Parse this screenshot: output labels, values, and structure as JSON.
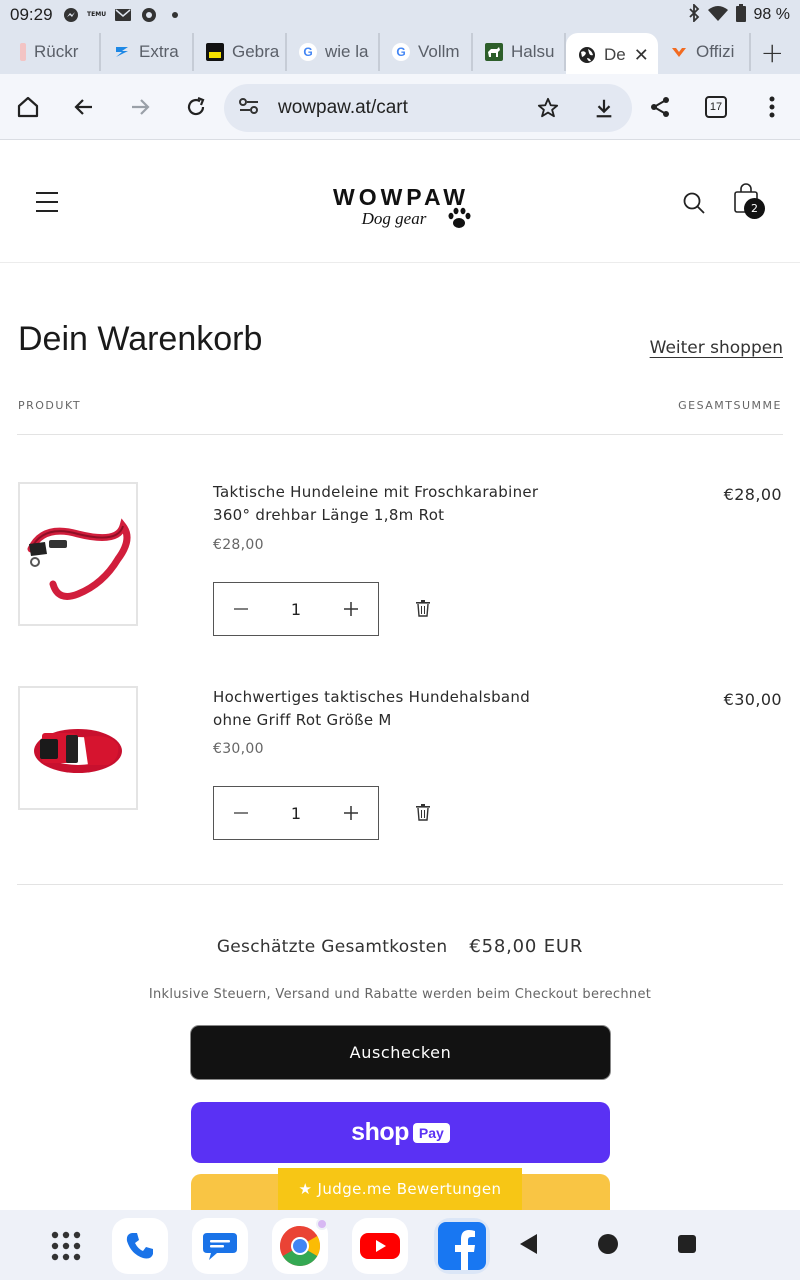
{
  "status_bar": {
    "time": "09:29",
    "battery": "98 %",
    "left_icons": [
      "messenger-icon",
      "temu-icon",
      "mail-icon",
      "chrome-icon",
      "dot-icon"
    ],
    "right_icons": [
      "bluetooth-icon",
      "wifi-icon",
      "battery-icon"
    ]
  },
  "tabs": [
    {
      "label": "Rückr",
      "icon": "rueckruf-favicon",
      "active": false
    },
    {
      "label": "Extra",
      "icon": "extra-favicon",
      "active": false
    },
    {
      "label": "Gebra",
      "icon": "gebra-favicon",
      "active": false
    },
    {
      "label": "wie la",
      "icon": "google-favicon",
      "active": false
    },
    {
      "label": "Vollm",
      "icon": "google-favicon",
      "active": false
    },
    {
      "label": "Halsu",
      "icon": "dog-favicon",
      "active": false
    },
    {
      "label": "De",
      "icon": "globe-favicon",
      "active": true
    },
    {
      "label": "Offizi",
      "icon": "orange-favicon",
      "active": false
    }
  ],
  "browser": {
    "url": "wowpaw.at/cart",
    "tab_count": "17"
  },
  "site": {
    "brand": "WOWPAW",
    "tagline": "Dog gear",
    "cart_count": "2"
  },
  "cart": {
    "title": "Dein Warenkorb",
    "continue_label": "Weiter shoppen",
    "col_product": "PRODUKT",
    "col_total": "GESAMTSUMME",
    "items": [
      {
        "name": "Taktische Hundeleine mit Froschkarabiner 360° drehbar Länge 1,8m Rot",
        "unit_price": "€28,00",
        "line_total": "€28,00",
        "quantity": "1"
      },
      {
        "name": "Hochwertiges taktisches Hundehalsband ohne Griff Rot Größe M",
        "unit_price": "€30,00",
        "line_total": "€30,00",
        "quantity": "1"
      }
    ],
    "subtotal_label": "Geschätzte Gesamtkosten",
    "subtotal_value": "€58,00 EUR",
    "tax_note": "Inklusive Steuern, Versand und Rabatte werden beim Checkout berechnet",
    "checkout_label": "Auschecken",
    "shoppay_shop": "shop",
    "shoppay_pay": "Pay",
    "judgeme_label": "★ Judge.me Bewertungen"
  },
  "taskbar": {
    "apps": [
      "app-drawer-icon",
      "phone-icon",
      "messages-icon",
      "chrome-icon",
      "youtube-icon",
      "facebook-icon"
    ],
    "nav": [
      "back-icon",
      "home-icon",
      "recents-icon"
    ]
  },
  "colors": {
    "shop_pay": "#5a31f4",
    "checkout": "#121212",
    "judgeme": "#f7c615",
    "browser_chrome": "#dfe5ef"
  }
}
